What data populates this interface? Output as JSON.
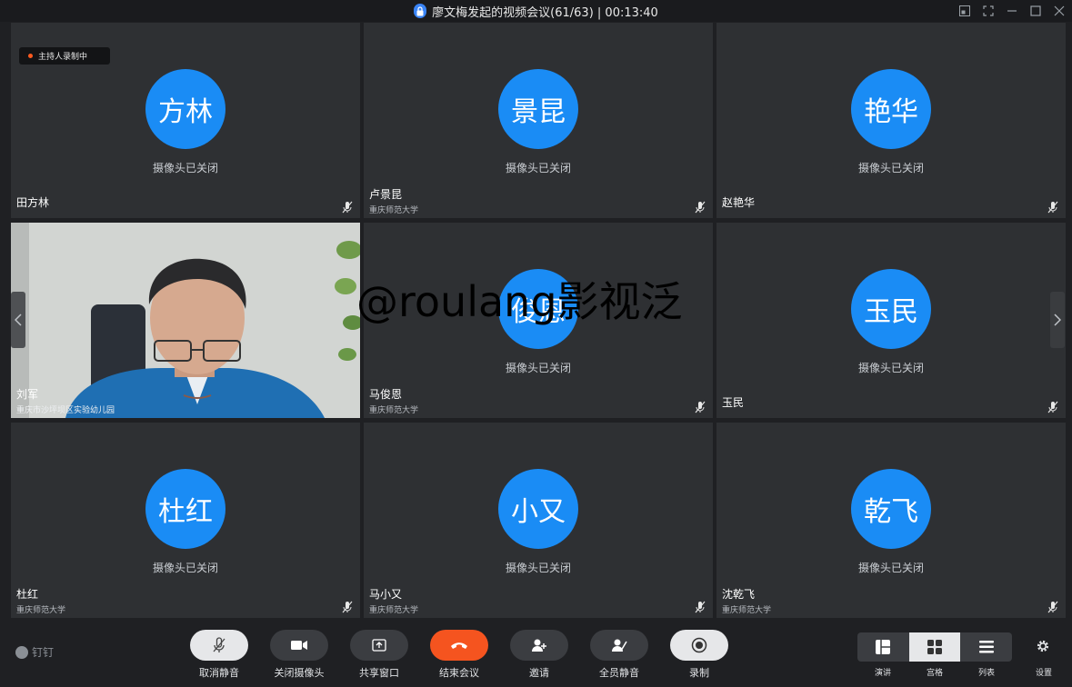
{
  "window": {
    "title": "廖文梅发起的视频会议(61/63) | 00:13:40"
  },
  "recording_badge": "主持人录制中",
  "camera_off_text": "摄像头已关闭",
  "tiles": [
    {
      "avatar": "方林",
      "name": "田方林",
      "org": ""
    },
    {
      "avatar": "景昆",
      "name": "卢景昆",
      "org": "重庆师范大学"
    },
    {
      "avatar": "艳华",
      "name": "赵艳华",
      "org": ""
    },
    {
      "avatar": "",
      "name": "刘军",
      "org": "重庆市沙坪坝区实验幼儿园"
    },
    {
      "avatar": "俊恩",
      "name": "马俊恩",
      "org": "重庆师范大学"
    },
    {
      "avatar": "玉民",
      "name": "玉民",
      "org": ""
    },
    {
      "avatar": "杜红",
      "name": "杜红",
      "org": "重庆师范大学"
    },
    {
      "avatar": "小又",
      "name": "马小又",
      "org": "重庆师范大学"
    },
    {
      "avatar": "乾飞",
      "name": "沈乾飞",
      "org": "重庆师范大学"
    }
  ],
  "watermark": "@roulang影视泛",
  "toolbar": {
    "brand": "钉钉",
    "buttons": [
      {
        "label": "取消静音",
        "icon": "mic-muted-icon"
      },
      {
        "label": "关闭摄像头",
        "icon": "camera-icon"
      },
      {
        "label": "共享窗口",
        "icon": "share-window-icon"
      },
      {
        "label": "结束会议",
        "icon": "hangup-icon"
      },
      {
        "label": "邀请",
        "icon": "invite-icon"
      },
      {
        "label": "全员静音",
        "icon": "mute-all-icon"
      },
      {
        "label": "录制",
        "icon": "record-icon"
      }
    ],
    "layouts": [
      {
        "label": "演讲",
        "active": false
      },
      {
        "label": "宫格",
        "active": true
      },
      {
        "label": "列表",
        "active": false
      }
    ],
    "settings_label": "设置"
  }
}
